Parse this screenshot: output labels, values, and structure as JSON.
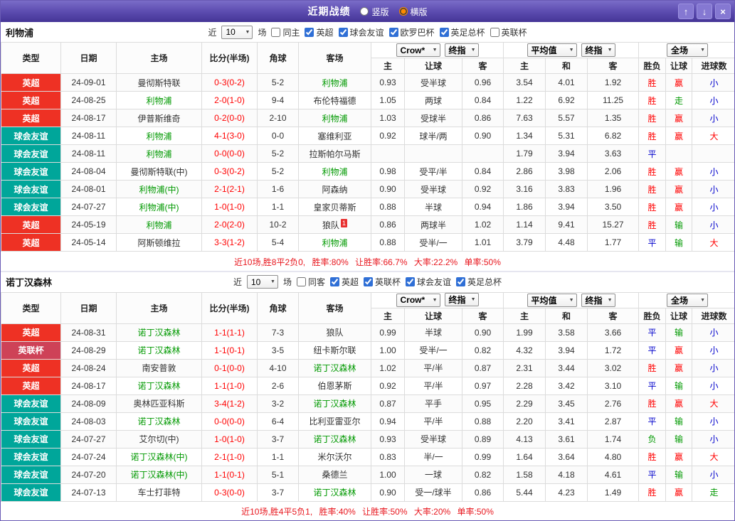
{
  "titlebar": {
    "title": "近期战绩",
    "vertical_label": "竖版",
    "horizontal_label": "横版",
    "selected_layout": "横版",
    "up_icon": "↑",
    "down_icon": "↓",
    "close_icon": "×"
  },
  "icons": {
    "dropdown_caret": "▼"
  },
  "columns": {
    "type": "类型",
    "date": "日期",
    "home": "主场",
    "score": "比分(半场)",
    "corner": "角球",
    "away": "客场",
    "odds_selects": [
      "Crow*",
      "终指"
    ],
    "avg_selects": [
      "平均值",
      "终指"
    ],
    "fulltime_select": "全场",
    "odds_sub": [
      "主",
      "让球",
      "客"
    ],
    "avg_sub": [
      "主",
      "和",
      "客"
    ],
    "result_sub": [
      "胜负",
      "让球",
      "进球数"
    ]
  },
  "colors": {
    "badge": {
      "英超": "#ee3124",
      "球会友谊": "#00a69a",
      "英联杯": "#ce4257"
    },
    "focus_team": "#009900",
    "score": "#ff0000",
    "outcome": {
      "胜": "#ff0000",
      "赢": "#ff0000",
      "大": "#ff0000",
      "平": "#0000cc",
      "小": "#0000cc",
      "负": "#009900",
      "输": "#009900",
      "走": "#009900"
    }
  },
  "sections": [
    {
      "team": "利物浦",
      "filter": {
        "prefix": "近",
        "count": "10",
        "suffix": "场",
        "same_side": {
          "label": "同主",
          "checked": false
        },
        "competitions": [
          {
            "label": "英超",
            "checked": true
          },
          {
            "label": "球会友谊",
            "checked": true
          },
          {
            "label": "欧罗巴杯",
            "checked": true
          },
          {
            "label": "英足总杯",
            "checked": true
          },
          {
            "label": "英联杯",
            "checked": false
          }
        ]
      },
      "rows": [
        {
          "type": "英超",
          "date": "24-09-01",
          "home": "曼彻斯特联",
          "home_focus": false,
          "score": "0-3(0-2)",
          "corner": "5-2",
          "away": "利物浦",
          "away_focus": true,
          "odds": [
            "0.93",
            "受半球",
            "0.96"
          ],
          "avg": [
            "3.54",
            "4.01",
            "1.92"
          ],
          "result": "胜",
          "handicap": "赢",
          "goals": "小"
        },
        {
          "type": "英超",
          "date": "24-08-25",
          "home": "利物浦",
          "home_focus": true,
          "score": "2-0(1-0)",
          "corner": "9-4",
          "away": "布伦特福德",
          "away_focus": false,
          "odds": [
            "1.05",
            "两球",
            "0.84"
          ],
          "avg": [
            "1.22",
            "6.92",
            "11.25"
          ],
          "result": "胜",
          "handicap": "走",
          "goals": "小"
        },
        {
          "type": "英超",
          "date": "24-08-17",
          "home": "伊普斯维奇",
          "home_focus": false,
          "score": "0-2(0-0)",
          "corner": "2-10",
          "away": "利物浦",
          "away_focus": true,
          "odds": [
            "1.03",
            "受球半",
            "0.86"
          ],
          "avg": [
            "7.63",
            "5.57",
            "1.35"
          ],
          "result": "胜",
          "handicap": "赢",
          "goals": "小"
        },
        {
          "type": "球会友谊",
          "date": "24-08-11",
          "home": "利物浦",
          "home_focus": true,
          "score": "4-1(3-0)",
          "corner": "0-0",
          "away": "塞维利亚",
          "away_focus": false,
          "odds": [
            "0.92",
            "球半/两",
            "0.90"
          ],
          "avg": [
            "1.34",
            "5.31",
            "6.82"
          ],
          "result": "胜",
          "handicap": "赢",
          "goals": "大"
        },
        {
          "type": "球会友谊",
          "date": "24-08-11",
          "home": "利物浦",
          "home_focus": true,
          "score": "0-0(0-0)",
          "corner": "5-2",
          "away": "拉斯帕尔马斯",
          "away_focus": false,
          "odds": [
            "",
            "",
            ""
          ],
          "avg": [
            "1.79",
            "3.94",
            "3.63"
          ],
          "result": "平",
          "handicap": "",
          "goals": ""
        },
        {
          "type": "球会友谊",
          "date": "24-08-04",
          "home": "曼彻斯特联(中)",
          "home_focus": false,
          "score": "0-3(0-2)",
          "corner": "5-2",
          "away": "利物浦",
          "away_focus": true,
          "odds": [
            "0.98",
            "受平/半",
            "0.84"
          ],
          "avg": [
            "2.86",
            "3.98",
            "2.06"
          ],
          "result": "胜",
          "handicap": "赢",
          "goals": "小"
        },
        {
          "type": "球会友谊",
          "date": "24-08-01",
          "home": "利物浦(中)",
          "home_focus": true,
          "score": "2-1(2-1)",
          "corner": "1-6",
          "away": "阿森纳",
          "away_focus": false,
          "odds": [
            "0.90",
            "受半球",
            "0.92"
          ],
          "avg": [
            "3.16",
            "3.83",
            "1.96"
          ],
          "result": "胜",
          "handicap": "赢",
          "goals": "小"
        },
        {
          "type": "球会友谊",
          "date": "24-07-27",
          "home": "利物浦(中)",
          "home_focus": true,
          "score": "1-0(1-0)",
          "corner": "1-1",
          "away": "皇家贝蒂斯",
          "away_focus": false,
          "odds": [
            "0.88",
            "半球",
            "0.94"
          ],
          "avg": [
            "1.86",
            "3.94",
            "3.50"
          ],
          "result": "胜",
          "handicap": "赢",
          "goals": "小"
        },
        {
          "type": "英超",
          "date": "24-05-19",
          "home": "利物浦",
          "home_focus": true,
          "score": "2-0(2-0)",
          "corner": "10-2",
          "away": "狼队",
          "away_focus": false,
          "away_sup": "1",
          "odds": [
            "0.86",
            "两球半",
            "1.02"
          ],
          "avg": [
            "1.14",
            "9.41",
            "15.27"
          ],
          "result": "胜",
          "handicap": "输",
          "goals": "小"
        },
        {
          "type": "英超",
          "date": "24-05-14",
          "home": "阿斯顿维拉",
          "home_focus": false,
          "score": "3-3(1-2)",
          "corner": "5-4",
          "away": "利物浦",
          "away_focus": true,
          "odds": [
            "0.88",
            "受半/一",
            "1.01"
          ],
          "avg": [
            "3.79",
            "4.48",
            "1.77"
          ],
          "result": "平",
          "handicap": "输",
          "goals": "大"
        }
      ],
      "summary": "近10场,胜8平2负0, 胜率:80% 让胜率:66.7% 大率:22.2% 单率:50%"
    },
    {
      "team": "诺丁汉森林",
      "filter": {
        "prefix": "近",
        "count": "10",
        "suffix": "场",
        "same_side": {
          "label": "同客",
          "checked": false
        },
        "competitions": [
          {
            "label": "英超",
            "checked": true
          },
          {
            "label": "英联杯",
            "checked": true
          },
          {
            "label": "球会友谊",
            "checked": true
          },
          {
            "label": "英足总杯",
            "checked": true
          }
        ]
      },
      "rows": [
        {
          "type": "英超",
          "date": "24-08-31",
          "home": "诺丁汉森林",
          "home_focus": true,
          "score": "1-1(1-1)",
          "corner": "7-3",
          "away": "狼队",
          "away_focus": false,
          "odds": [
            "0.99",
            "半球",
            "0.90"
          ],
          "avg": [
            "1.99",
            "3.58",
            "3.66"
          ],
          "result": "平",
          "handicap": "输",
          "goals": "小"
        },
        {
          "type": "英联杯",
          "date": "24-08-29",
          "home": "诺丁汉森林",
          "home_focus": true,
          "score": "1-1(0-1)",
          "corner": "3-5",
          "away": "纽卡斯尔联",
          "away_focus": false,
          "odds": [
            "1.00",
            "受半/一",
            "0.82"
          ],
          "avg": [
            "4.32",
            "3.94",
            "1.72"
          ],
          "result": "平",
          "handicap": "赢",
          "goals": "小"
        },
        {
          "type": "英超",
          "date": "24-08-24",
          "home": "南安普敦",
          "home_focus": false,
          "score": "0-1(0-0)",
          "corner": "4-10",
          "away": "诺丁汉森林",
          "away_focus": true,
          "odds": [
            "1.02",
            "平/半",
            "0.87"
          ],
          "avg": [
            "2.31",
            "3.44",
            "3.02"
          ],
          "result": "胜",
          "handicap": "赢",
          "goals": "小"
        },
        {
          "type": "英超",
          "date": "24-08-17",
          "home": "诺丁汉森林",
          "home_focus": true,
          "score": "1-1(1-0)",
          "corner": "2-6",
          "away": "伯恩茅斯",
          "away_focus": false,
          "odds": [
            "0.92",
            "平/半",
            "0.97"
          ],
          "avg": [
            "2.28",
            "3.42",
            "3.10"
          ],
          "result": "平",
          "handicap": "输",
          "goals": "小"
        },
        {
          "type": "球会友谊",
          "date": "24-08-09",
          "home": "奥林匹亚科斯",
          "home_focus": false,
          "score": "3-4(1-2)",
          "corner": "3-2",
          "away": "诺丁汉森林",
          "away_focus": true,
          "odds": [
            "0.87",
            "平手",
            "0.95"
          ],
          "avg": [
            "2.29",
            "3.45",
            "2.76"
          ],
          "result": "胜",
          "handicap": "赢",
          "goals": "大"
        },
        {
          "type": "球会友谊",
          "date": "24-08-03",
          "home": "诺丁汉森林",
          "home_focus": true,
          "score": "0-0(0-0)",
          "corner": "6-4",
          "away": "比利亚雷亚尔",
          "away_focus": false,
          "odds": [
            "0.94",
            "平/半",
            "0.88"
          ],
          "avg": [
            "2.20",
            "3.41",
            "2.87"
          ],
          "result": "平",
          "handicap": "输",
          "goals": "小"
        },
        {
          "type": "球会友谊",
          "date": "24-07-27",
          "home": "艾尔切(中)",
          "home_focus": false,
          "score": "1-0(1-0)",
          "corner": "3-7",
          "away": "诺丁汉森林",
          "away_focus": true,
          "odds": [
            "0.93",
            "受半球",
            "0.89"
          ],
          "avg": [
            "4.13",
            "3.61",
            "1.74"
          ],
          "result": "负",
          "handicap": "输",
          "goals": "小"
        },
        {
          "type": "球会友谊",
          "date": "24-07-24",
          "home": "诺丁汉森林(中)",
          "home_focus": true,
          "score": "2-1(1-0)",
          "corner": "1-1",
          "away": "米尔沃尔",
          "away_focus": false,
          "odds": [
            "0.83",
            "半/一",
            "0.99"
          ],
          "avg": [
            "1.64",
            "3.64",
            "4.80"
          ],
          "result": "胜",
          "handicap": "赢",
          "goals": "大"
        },
        {
          "type": "球会友谊",
          "date": "24-07-20",
          "home": "诺丁汉森林(中)",
          "home_focus": true,
          "score": "1-1(0-1)",
          "corner": "5-1",
          "away": "桑德兰",
          "away_focus": false,
          "odds": [
            "1.00",
            "一球",
            "0.82"
          ],
          "avg": [
            "1.58",
            "4.18",
            "4.61"
          ],
          "result": "平",
          "handicap": "输",
          "goals": "小"
        },
        {
          "type": "球会友谊",
          "date": "24-07-13",
          "home": "车士打菲特",
          "home_focus": false,
          "score": "0-3(0-0)",
          "corner": "3-7",
          "away": "诺丁汉森林",
          "away_focus": true,
          "odds": [
            "0.90",
            "受一/球半",
            "0.86"
          ],
          "avg": [
            "5.44",
            "4.23",
            "1.49"
          ],
          "result": "胜",
          "handicap": "赢",
          "goals": "走"
        }
      ],
      "summary": "近10场,胜4平5负1, 胜率:40% 让胜率:50% 大率:20% 单率:50%"
    }
  ]
}
